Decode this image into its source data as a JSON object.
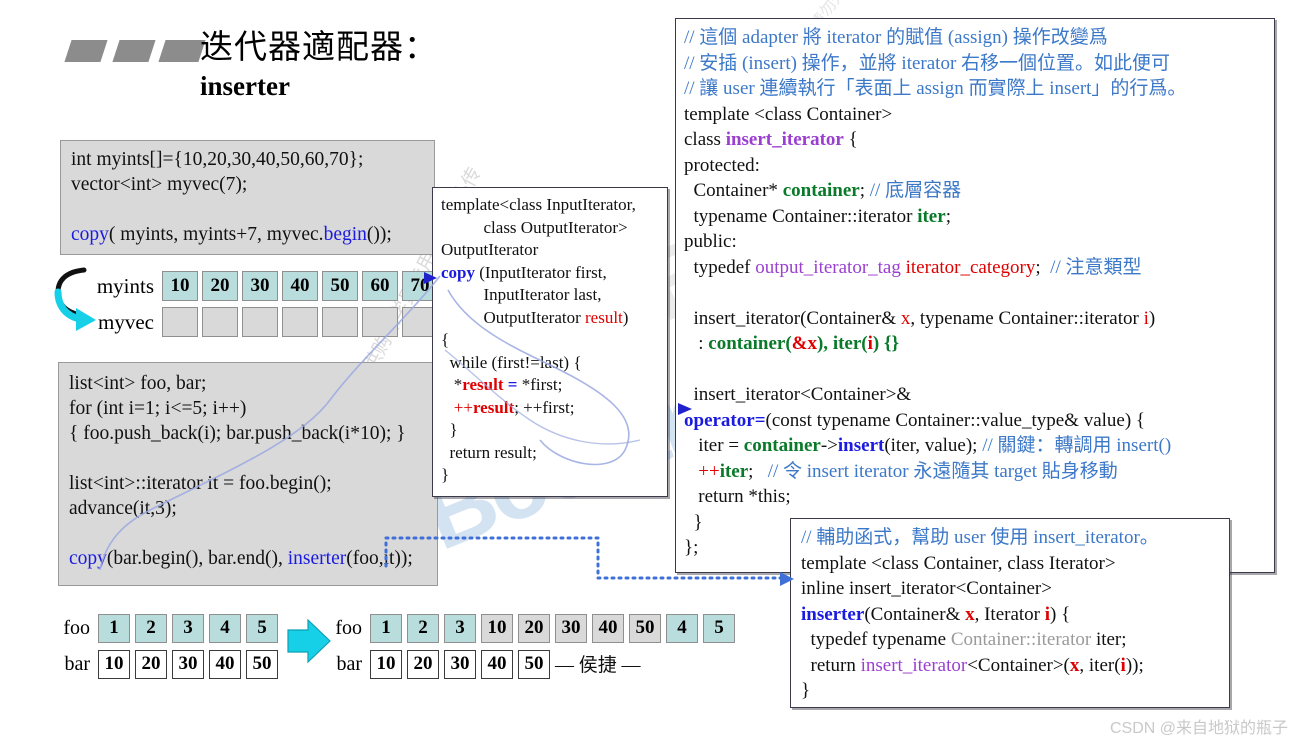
{
  "title": {
    "chinese": "迭代器適配器：",
    "english": "inserter"
  },
  "code_top": {
    "lines": [
      {
        "segments": [
          {
            "t": "int myints[]={10,20,30,40,50,60,70};",
            "c": "plain"
          }
        ]
      },
      {
        "segments": [
          {
            "t": "vector<int> myvec(7);",
            "c": "plain"
          }
        ]
      },
      {
        "segments": [
          {
            "t": "",
            "c": "plain"
          }
        ]
      },
      {
        "segments": [
          {
            "t": "copy",
            "c": "kw-blue"
          },
          {
            "t": "( myints, myints+7, myvec.",
            "c": "plain"
          },
          {
            "t": "begin",
            "c": "kw-blue"
          },
          {
            "t": "());",
            "c": "plain"
          }
        ]
      }
    ]
  },
  "code_bottom": {
    "lines": [
      {
        "segments": [
          {
            "t": "list<int> foo, bar;",
            "c": "plain"
          }
        ]
      },
      {
        "segments": [
          {
            "t": "for (int i=1; i<=5; i++)",
            "c": "plain"
          }
        ]
      },
      {
        "segments": [
          {
            "t": "{ foo.push_back(i); bar.push_back(i*10); }",
            "c": "plain"
          }
        ]
      },
      {
        "segments": [
          {
            "t": "",
            "c": "plain"
          }
        ]
      },
      {
        "segments": [
          {
            "t": "list<int>::iterator it = foo.begin();",
            "c": "plain"
          }
        ]
      },
      {
        "segments": [
          {
            "t": "advance(it,3);",
            "c": "plain"
          }
        ]
      },
      {
        "segments": [
          {
            "t": "",
            "c": "plain"
          }
        ]
      },
      {
        "segments": [
          {
            "t": "copy",
            "c": "kw-blue"
          },
          {
            "t": "(bar.begin(), bar.end(), ",
            "c": "plain"
          },
          {
            "t": "inserter",
            "c": "kw-blue"
          },
          {
            "t": "(foo,it));",
            "c": "plain"
          }
        ]
      }
    ]
  },
  "box_copy": {
    "lines": [
      {
        "segments": [
          {
            "t": "template<class InputIterator,",
            "c": "plain"
          }
        ]
      },
      {
        "segments": [
          {
            "t": "          class OutputIterator>",
            "c": "plain"
          }
        ]
      },
      {
        "segments": [
          {
            "t": "OutputIterator",
            "c": "plain"
          }
        ]
      },
      {
        "segments": [
          {
            "t": "copy",
            "c": "kw-blue-b"
          },
          {
            "t": " (InputIterator first,",
            "c": "plain"
          }
        ]
      },
      {
        "segments": [
          {
            "t": "          InputIterator last,",
            "c": "plain"
          }
        ]
      },
      {
        "segments": [
          {
            "t": "          OutputIterator ",
            "c": "plain"
          },
          {
            "t": "result",
            "c": "kw-red"
          },
          {
            "t": ")",
            "c": "plain"
          }
        ]
      },
      {
        "segments": [
          {
            "t": "{",
            "c": "plain"
          }
        ]
      },
      {
        "segments": [
          {
            "t": "  while (first!=last) {",
            "c": "plain"
          }
        ]
      },
      {
        "segments": [
          {
            "t": "   *",
            "c": "plain"
          },
          {
            "t": "result",
            "c": "kw-red-b"
          },
          {
            "t": " ",
            "c": "plain"
          },
          {
            "t": "=",
            "c": "kw-blue-b"
          },
          {
            "t": " *first;",
            "c": "plain"
          }
        ]
      },
      {
        "segments": [
          {
            "t": "   ++",
            "c": "kw-red"
          },
          {
            "t": "result",
            "c": "kw-red-b"
          },
          {
            "t": "; ++first;",
            "c": "plain"
          }
        ]
      },
      {
        "segments": [
          {
            "t": "  }",
            "c": "plain"
          }
        ]
      },
      {
        "segments": [
          {
            "t": "  return result;",
            "c": "plain"
          }
        ]
      },
      {
        "segments": [
          {
            "t": "}",
            "c": "plain"
          }
        ]
      }
    ]
  },
  "box_insert_iterator": {
    "lines": [
      {
        "segments": [
          {
            "t": "// 這個 adapter 將 iterator 的賦值 (assign) 操作改變爲",
            "c": "kw-comment"
          }
        ]
      },
      {
        "segments": [
          {
            "t": "// 安插 (insert) 操作，並將 iterator 右移一個位置。如此便可",
            "c": "kw-comment"
          }
        ]
      },
      {
        "segments": [
          {
            "t": "// 讓 user 連續執行「表面上 assign 而實際上 insert」的行爲。",
            "c": "kw-comment"
          }
        ]
      },
      {
        "segments": [
          {
            "t": "template <class Container>",
            "c": "plain"
          }
        ]
      },
      {
        "segments": [
          {
            "t": "class ",
            "c": "plain"
          },
          {
            "t": "insert_iterator",
            "c": "kw-purple-b"
          },
          {
            "t": " {",
            "c": "plain"
          }
        ]
      },
      {
        "segments": [
          {
            "t": "protected:",
            "c": "plain"
          }
        ]
      },
      {
        "segments": [
          {
            "t": "  Container* ",
            "c": "plain"
          },
          {
            "t": "container",
            "c": "kw-green-b"
          },
          {
            "t": "; ",
            "c": "plain"
          },
          {
            "t": "// 底層容器",
            "c": "kw-comment"
          }
        ]
      },
      {
        "segments": [
          {
            "t": "  typename Container::iterator ",
            "c": "plain"
          },
          {
            "t": "iter",
            "c": "kw-green-b"
          },
          {
            "t": ";",
            "c": "plain"
          }
        ]
      },
      {
        "segments": [
          {
            "t": "public:",
            "c": "plain"
          }
        ]
      },
      {
        "segments": [
          {
            "t": "  typedef ",
            "c": "plain"
          },
          {
            "t": "output_iterator_tag",
            "c": "kw-purple"
          },
          {
            "t": " ",
            "c": "plain"
          },
          {
            "t": "iterator_category",
            "c": "kw-red"
          },
          {
            "t": ";  ",
            "c": "plain"
          },
          {
            "t": "// 注意類型",
            "c": "kw-comment"
          }
        ]
      },
      {
        "segments": [
          {
            "t": "",
            "c": "plain"
          }
        ]
      },
      {
        "segments": [
          {
            "t": "  insert_iterator(Container& ",
            "c": "plain"
          },
          {
            "t": "x",
            "c": "kw-red"
          },
          {
            "t": ", typename Container::iterator ",
            "c": "plain"
          },
          {
            "t": "i",
            "c": "kw-red"
          },
          {
            "t": ")",
            "c": "plain"
          }
        ]
      },
      {
        "segments": [
          {
            "t": "   : ",
            "c": "plain"
          },
          {
            "t": "container",
            "c": "kw-green-b"
          },
          {
            "t": "(",
            "c": "kw-green-b"
          },
          {
            "t": "&x",
            "c": "kw-red-b"
          },
          {
            "t": "), ",
            "c": "kw-green-b"
          },
          {
            "t": "iter",
            "c": "kw-green-b"
          },
          {
            "t": "(",
            "c": "kw-green-b"
          },
          {
            "t": "i",
            "c": "kw-red-b"
          },
          {
            "t": ") {}",
            "c": "kw-green-b"
          }
        ]
      },
      {
        "segments": [
          {
            "t": "",
            "c": "plain"
          }
        ]
      },
      {
        "segments": [
          {
            "t": "  insert_iterator<Container>&",
            "c": "plain"
          }
        ]
      },
      {
        "segments": [
          {
            "t": "operator=",
            "c": "kw-blue-b"
          },
          {
            "t": "(const typename Container::value_type& value) {",
            "c": "plain"
          }
        ]
      },
      {
        "segments": [
          {
            "t": "   iter = ",
            "c": "plain"
          },
          {
            "t": "container",
            "c": "kw-green-b"
          },
          {
            "t": "->",
            "c": "plain"
          },
          {
            "t": "insert",
            "c": "kw-blue-b"
          },
          {
            "t": "(iter, value); ",
            "c": "plain"
          },
          {
            "t": "// 關鍵：轉調用 insert()",
            "c": "kw-comment"
          }
        ]
      },
      {
        "segments": [
          {
            "t": "   ++",
            "c": "kw-red"
          },
          {
            "t": "iter",
            "c": "kw-green-b"
          },
          {
            "t": ";   ",
            "c": "plain"
          },
          {
            "t": "// 令 insert iterator 永遠隨其 target 貼身移動",
            "c": "kw-comment"
          }
        ]
      },
      {
        "segments": [
          {
            "t": "   return *this;",
            "c": "plain"
          }
        ]
      },
      {
        "segments": [
          {
            "t": "  }",
            "c": "plain"
          }
        ]
      },
      {
        "segments": [
          {
            "t": "};",
            "c": "plain"
          }
        ]
      }
    ]
  },
  "box_inserter": {
    "lines": [
      {
        "segments": [
          {
            "t": "// 輔助函式，幫助 user 使用 insert_iterator。",
            "c": "kw-comment"
          }
        ]
      },
      {
        "segments": [
          {
            "t": "template <class Container, class Iterator>",
            "c": "plain"
          }
        ]
      },
      {
        "segments": [
          {
            "t": "inline insert_iterator<Container>",
            "c": "plain"
          }
        ]
      },
      {
        "segments": [
          {
            "t": "inserter",
            "c": "kw-blue-b"
          },
          {
            "t": "(Container& ",
            "c": "plain"
          },
          {
            "t": "x",
            "c": "kw-red-b"
          },
          {
            "t": ", Iterator ",
            "c": "plain"
          },
          {
            "t": "i",
            "c": "kw-red-b"
          },
          {
            "t": ") {",
            "c": "plain"
          }
        ]
      },
      {
        "segments": [
          {
            "t": "  typedef typename ",
            "c": "plain"
          },
          {
            "t": "Container::iterator",
            "c": "kw-gray"
          },
          {
            "t": " iter;",
            "c": "plain"
          }
        ]
      },
      {
        "segments": [
          {
            "t": "  return ",
            "c": "plain"
          },
          {
            "t": "insert_iterator",
            "c": "kw-purple"
          },
          {
            "t": "<Container>(",
            "c": "plain"
          },
          {
            "t": "x",
            "c": "kw-red-b"
          },
          {
            "t": ", iter(",
            "c": "plain"
          },
          {
            "t": "i",
            "c": "kw-red-b"
          },
          {
            "t": "));",
            "c": "plain"
          }
        ]
      },
      {
        "segments": [
          {
            "t": "}",
            "c": "plain"
          }
        ]
      }
    ]
  },
  "arrays": {
    "myints": {
      "label": "myints",
      "cells": [
        {
          "v": "10",
          "s": "teal"
        },
        {
          "v": "20",
          "s": "teal"
        },
        {
          "v": "30",
          "s": "teal"
        },
        {
          "v": "40",
          "s": "teal"
        },
        {
          "v": "50",
          "s": "teal"
        },
        {
          "v": "60",
          "s": "teal"
        },
        {
          "v": "70",
          "s": "teal"
        }
      ]
    },
    "myvec": {
      "label": "myvec",
      "cells": [
        {
          "v": "",
          "s": "empty"
        },
        {
          "v": "",
          "s": "empty"
        },
        {
          "v": "",
          "s": "empty"
        },
        {
          "v": "",
          "s": "empty"
        },
        {
          "v": "",
          "s": "empty"
        },
        {
          "v": "",
          "s": "empty"
        },
        {
          "v": "",
          "s": "empty"
        }
      ]
    },
    "foo_before": {
      "label": "foo",
      "cells": [
        {
          "v": "1",
          "s": "teal"
        },
        {
          "v": "2",
          "s": "teal"
        },
        {
          "v": "3",
          "s": "teal"
        },
        {
          "v": "4",
          "s": "teal"
        },
        {
          "v": "5",
          "s": "teal"
        }
      ]
    },
    "bar_before": {
      "label": "bar",
      "cells": [
        {
          "v": "10",
          "s": "white"
        },
        {
          "v": "20",
          "s": "white"
        },
        {
          "v": "30",
          "s": "white"
        },
        {
          "v": "40",
          "s": "white"
        },
        {
          "v": "50",
          "s": "white"
        }
      ]
    },
    "foo_after": {
      "label": "foo",
      "cells": [
        {
          "v": "1",
          "s": "teal"
        },
        {
          "v": "2",
          "s": "teal"
        },
        {
          "v": "3",
          "s": "teal"
        },
        {
          "v": "10",
          "s": "gray"
        },
        {
          "v": "20",
          "s": "gray"
        },
        {
          "v": "30",
          "s": "gray"
        },
        {
          "v": "40",
          "s": "gray"
        },
        {
          "v": "50",
          "s": "gray"
        },
        {
          "v": "4",
          "s": "teal"
        },
        {
          "v": "5",
          "s": "teal"
        }
      ]
    },
    "bar_after": {
      "label": "bar",
      "cells": [
        {
          "v": "10",
          "s": "white"
        },
        {
          "v": "20",
          "s": "white"
        },
        {
          "v": "30",
          "s": "white"
        },
        {
          "v": "40",
          "s": "white"
        },
        {
          "v": "50",
          "s": "white"
        }
      ]
    }
  },
  "signature": "— 侯捷 —",
  "watermarks": {
    "boolan": "Boolan",
    "diagonal": "本讲义仅供购课学员专用，请勿外传",
    "csdn": "CSDN @来自地狱的瓶子"
  },
  "colors": {
    "teal_cell": "#b9dcdc",
    "gray_cell": "#d9d9d9",
    "code_bg": "#d9d9d9",
    "blue_kw": "#1a1ae0",
    "red_kw": "#e00000",
    "green_kw": "#0a7a2a",
    "purple_kw": "#9b3fd0",
    "comment_blue": "#3c78c8",
    "arrow_cyan": "#16d0e8",
    "connector_blue": "#3f6fd8"
  }
}
